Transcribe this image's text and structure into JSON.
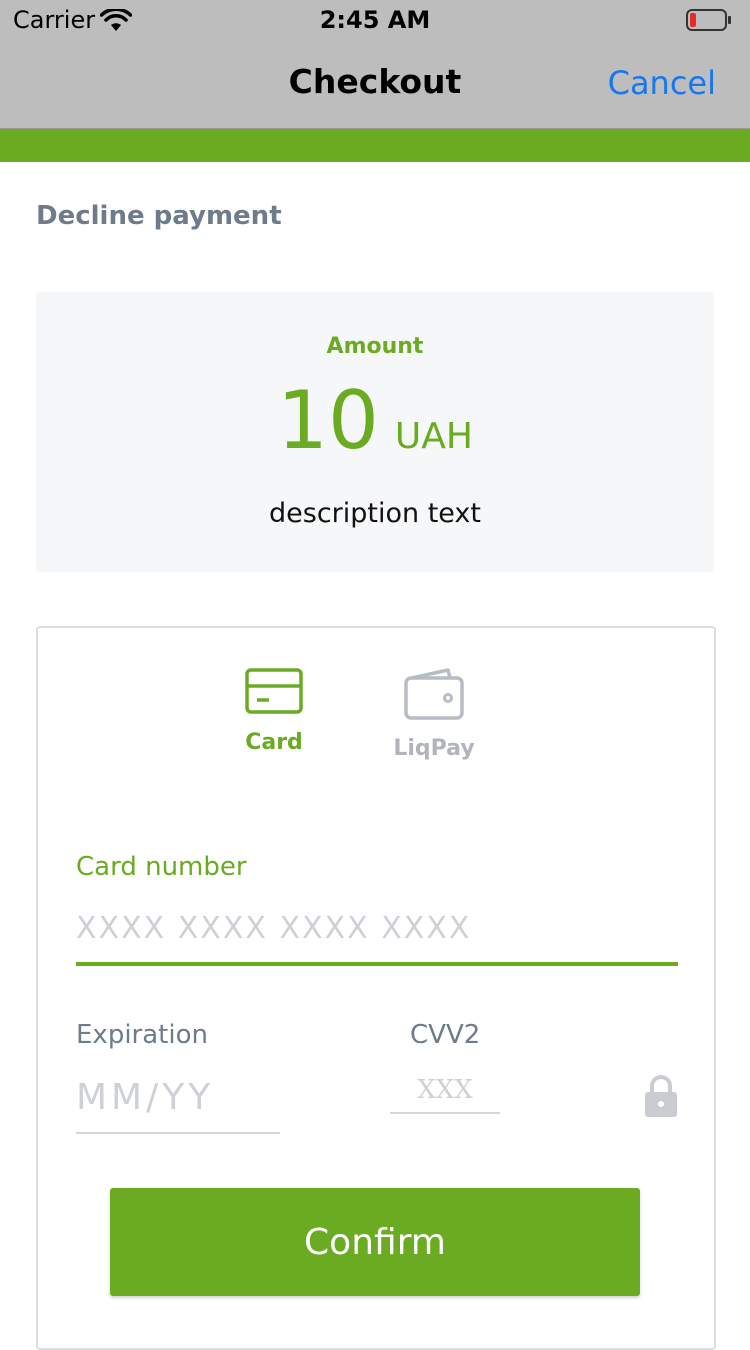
{
  "status_bar": {
    "carrier": "Carrier",
    "time": "2:45 AM",
    "icons": [
      "wifi-icon",
      "battery-low-icon"
    ],
    "battery_color": "#e52b2b"
  },
  "nav": {
    "title": "Checkout",
    "cancel_label": "Cancel"
  },
  "colors": {
    "accent": "#6aab22",
    "nav_bg": "#bdbdbd",
    "link_blue": "#1677f0",
    "muted_text": "#6e7b8c"
  },
  "decline_label": "Decline payment",
  "amount": {
    "label": "Amount",
    "value": "10",
    "currency": "UAH",
    "description": "description text"
  },
  "payment_methods": [
    {
      "label": "Card",
      "icon": "credit-card-icon",
      "selected": true
    },
    {
      "label": "LiqPay",
      "icon": "wallet-icon",
      "selected": false
    }
  ],
  "form": {
    "card_number": {
      "label": "Card number",
      "placeholder": "XXXX XXXX XXXX XXXX",
      "value": ""
    },
    "expiration": {
      "label": "Expiration",
      "placeholder": "MM/YY",
      "value": ""
    },
    "cvv": {
      "label": "CVV2",
      "placeholder": "XXX",
      "value": "",
      "icon": "lock-icon"
    },
    "confirm_label": "Confirm"
  }
}
